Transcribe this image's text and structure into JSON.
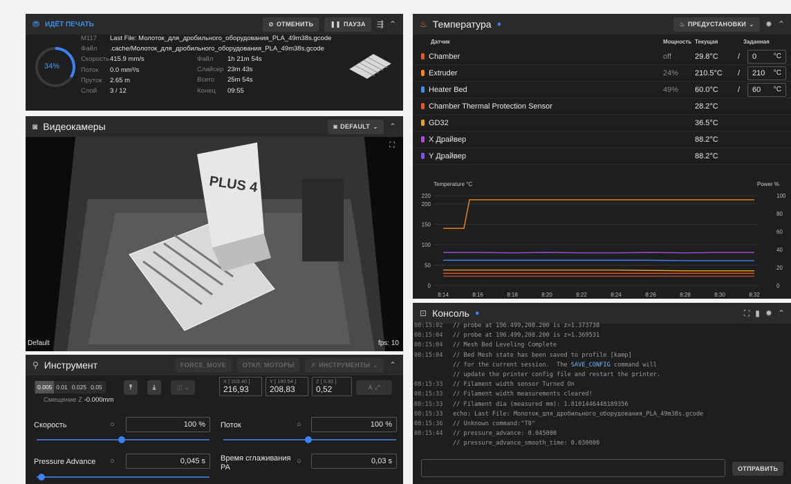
{
  "print": {
    "status": "ИДЁТ ПЕЧАТЬ",
    "cancel": "ОТМЕНИТЬ",
    "pause": "ПАУЗА",
    "progress": "34%",
    "progress_value": 0.34,
    "m117_label": "M117",
    "m117_value": "Last File: Молоток_для_дробильного_оборудования_PLA_49m38s.gcode",
    "file_label": "Файл",
    "file_value": ".cache/Молоток_для_дробильного_оборудования_PLA_49m38s.gcode",
    "speed_label": "Скорость",
    "speed_value": "415.9 mm/s",
    "flow_label": "Поток",
    "flow_value": "0.0 mm³/s",
    "filament_label": "Пруток",
    "filament_value": "2.65 m",
    "layer_label": "Слой",
    "layer_value": "3 / 12",
    "file2_label": "Файл",
    "file2_value": "1h 21m 54s",
    "slicer_label": "Слайсер",
    "slicer_value": "23m 43s",
    "total_label": "Всего",
    "total_value": "25m 54s",
    "end_label": "Конец",
    "end_value": "09:55"
  },
  "camera": {
    "title": "Видеокамеры",
    "preset": "DEFAULT",
    "name": "Default",
    "fps": "fps: 10",
    "box_text": "PLUS 4"
  },
  "tool": {
    "title": "Инструмент",
    "force_move": "FORCE_MOVE",
    "motors_off": "ОТКЛ. МОТОРЫ",
    "tools": "ИНСТРУМЕНТЫ",
    "steps": [
      "0.005",
      "0.01",
      "0.025",
      "0.05"
    ],
    "z_offset_label": "Смещение Z",
    "z_offset_value": "-0.000mm",
    "x_label": "X [ 203.40 ]",
    "x_value": "216,93",
    "y_label": "Y [ 190.54 ]",
    "y_value": "208,83",
    "z_label": "Z [ 0.92 ]",
    "z_value": "0,52",
    "speed_label": "Скорость",
    "speed_value": "100 %",
    "flow_label": "Поток",
    "flow_value": "100 %",
    "pa_label": "Pressure Advance",
    "pa_value": "0,045 s",
    "smooth_label": "Время сглаживания PA",
    "smooth_value": "0,03 s"
  },
  "temperature": {
    "title": "Температура",
    "presets": "ПРЕДУСТАНОВКИ",
    "col_sensor": "Датчик",
    "col_power": "Мощность",
    "col_current": "Текущая",
    "col_target": "Заданная",
    "rows": [
      {
        "name": "Chamber",
        "power": "off",
        "current": "29.8°C",
        "target": "0",
        "unit": "°C",
        "color": "#e8572a"
      },
      {
        "name": "Extruder",
        "power": "24%",
        "current": "210.5°C",
        "target": "210",
        "unit": "°C",
        "color": "#f08a1e"
      },
      {
        "name": "Heater Bed",
        "power": "49%",
        "current": "60.0°C",
        "target": "60",
        "unit": "°C",
        "color": "#3b8fe6"
      },
      {
        "name": "Chamber Thermal Protection Sensor",
        "power": "",
        "current": "28.2°C",
        "target": "",
        "unit": "",
        "color": "#e8572a"
      },
      {
        "name": "GD32",
        "power": "",
        "current": "36.5°C",
        "target": "",
        "unit": "",
        "color": "#f0a01e"
      },
      {
        "name": "X Драйвер",
        "power": "",
        "current": "88.2°C",
        "target": "",
        "unit": "",
        "color": "#b04de0"
      },
      {
        "name": "Y Драйвер",
        "power": "",
        "current": "88.2°C",
        "target": "",
        "unit": "",
        "color": "#8a4de0"
      }
    ]
  },
  "chart_data": {
    "type": "line",
    "ylabel": "Temperature °C",
    "y2label": "Power %",
    "ylim": [
      0,
      220
    ],
    "y2lim": [
      0,
      100
    ],
    "yticks": [
      "220",
      "200",
      "150",
      "100",
      "50",
      "0"
    ],
    "y2ticks": [
      "100",
      "80",
      "60",
      "40",
      "20",
      "0"
    ],
    "x": [
      "8:14",
      "8:16",
      "8:18",
      "8:20",
      "8:22",
      "8:24",
      "8:26",
      "8:28",
      "8:30",
      "8:32"
    ],
    "series": [
      {
        "color": "#f08a1e",
        "values": [
          140,
          210,
          210,
          210,
          210,
          210,
          210,
          210,
          210,
          210
        ]
      },
      {
        "color": "#9b4de0",
        "values": [
          81,
          81,
          80,
          81,
          80,
          80,
          81,
          80,
          81,
          81
        ]
      },
      {
        "color": "#3b82f6",
        "values": [
          62,
          62,
          62,
          62,
          62,
          62,
          62,
          61,
          61,
          61
        ]
      },
      {
        "color": "#e8572a",
        "values": [
          30,
          30,
          30,
          30,
          30,
          30,
          30,
          30,
          30,
          30
        ]
      },
      {
        "color": "#c0462a",
        "values": [
          23,
          23,
          23,
          23,
          23,
          23,
          23,
          23,
          23,
          23
        ]
      },
      {
        "color": "#f0a01e",
        "values": [
          38,
          38,
          38,
          38,
          38,
          38,
          37,
          36,
          36,
          36
        ]
      }
    ]
  },
  "console": {
    "title": "Консоль",
    "send": "ОТПРАВИТЬ",
    "lines": [
      {
        "t": "08:15:02",
        "m": "// probe at 196.499,208.200 is z=1.373738"
      },
      {
        "t": "08:15:04",
        "m": "// probe at 196.499,208.200 is z=1.369531"
      },
      {
        "t": "08:15:04",
        "m": "// Mesh Bed Leveling Complete"
      },
      {
        "t": "08:15:04",
        "m": "// Bed Mesh state has been saved to profile [kamp]"
      },
      {
        "t": "",
        "m": "// for the current session.  The SAVE_CONFIG command will"
      },
      {
        "t": "",
        "m": "// update the printer config file and restart the printer."
      },
      {
        "t": "08:15:33",
        "m": "// Filament width sensor Turned On"
      },
      {
        "t": "08:15:33",
        "m": "// Filament width measurements cleared!"
      },
      {
        "t": "08:15:33",
        "m": "// Filament dia (measured mm): 1.8101446448189356"
      },
      {
        "t": "08:15:33",
        "m": "echo: Last File: Молоток_для_дробильного_оборудования_PLA_49m38s.gcode"
      },
      {
        "t": "08:15:36",
        "m": "// Unknown command:\"T0\""
      },
      {
        "t": "08:15:44",
        "m": "// pressure_advance: 0.045000"
      },
      {
        "t": "",
        "m": "// pressure_advance_smooth_time: 0.030000"
      }
    ]
  }
}
